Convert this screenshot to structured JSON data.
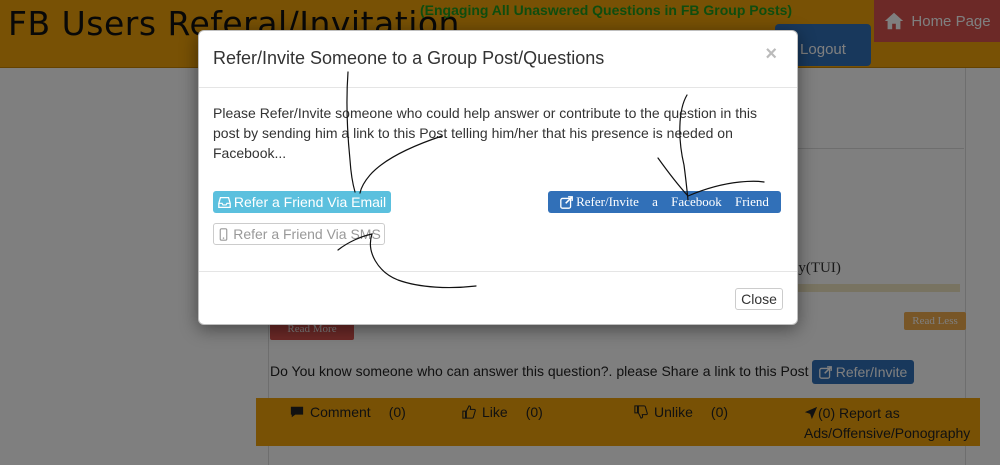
{
  "header": {
    "site_title": "FB Users Referal/Invitation",
    "tagline": "(Engaging All Unaswered Questions in FB Group Posts)",
    "logout_label": "Logout",
    "home_label": "Home Page"
  },
  "page": {
    "ghost_text": "ity(TUI)",
    "read_more_label": "Read More",
    "read_less_label": "Read Less",
    "share_prompt": "Do You know someone who can answer this question?. please Share a link to this Post",
    "share_button_label": "Refer/Invite",
    "actions": {
      "comment_label": "Comment",
      "comment_count": "(0)",
      "like_label": "Like",
      "like_count": "(0)",
      "unlike_label": "Unlike",
      "unlike_count": "(0)",
      "report_line1": "(0) Report as",
      "report_line2": "Ads/Offensive/Ponography"
    }
  },
  "modal": {
    "title": "Refer/Invite Someone to a Group Post/Questions",
    "close_x": "×",
    "body": "Please Refer/Invite someone who could help answer or contribute to the question in this post by sending him a link to this Post telling him/her that his presence is needed on Facebook...",
    "email_button": "Refer a Friend Via Email",
    "sms_button": "Refer a Friend Via SMS",
    "facebook_button": "Refer/Invite a Facebook Friend",
    "close_button": "Close"
  },
  "colors": {
    "header_bg": "#f0a30a",
    "tagline": "#1f9a1f",
    "primary": "#3170b8",
    "danger": "#d9534f",
    "info": "#5bc0de",
    "warning": "#f0ad4e"
  },
  "icons": [
    "home-icon",
    "logout-icon",
    "share-icon",
    "comment-icon",
    "thumbs-up-icon",
    "thumbs-down-icon",
    "send-icon",
    "inbox-icon",
    "mobile-phone-icon"
  ]
}
